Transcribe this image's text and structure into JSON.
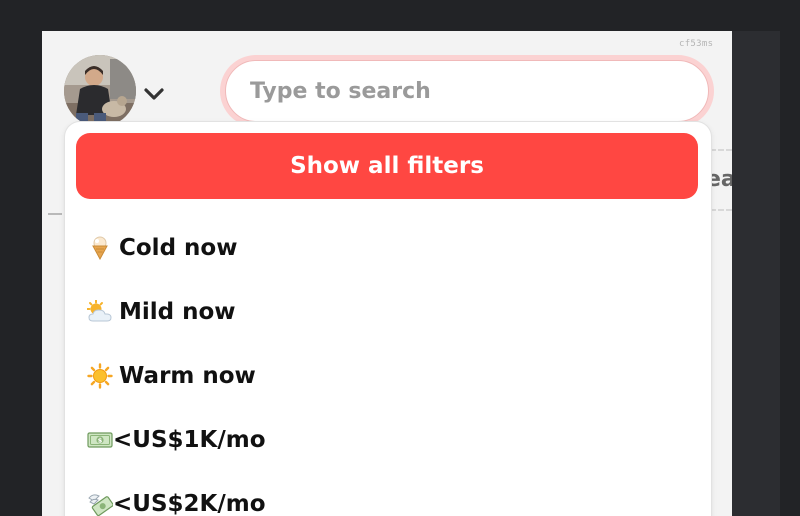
{
  "header": {
    "timing_label": "cf53ms",
    "avatar_icon": "user-avatar-photo",
    "avatar_menu_icon": "chevron-down-icon"
  },
  "search": {
    "placeholder": "Type to search",
    "value": ""
  },
  "background": {
    "partial_text": "ea"
  },
  "dropdown": {
    "show_all_label": "Show all filters",
    "items": [
      {
        "icon": "ice-cream-icon",
        "label": "Cold now"
      },
      {
        "icon": "sun-behind-cloud-icon",
        "label": "Mild now"
      },
      {
        "icon": "sun-icon",
        "label": "Warm now"
      },
      {
        "icon": "dollar-banknote-icon",
        "label": "<US$1K/mo"
      },
      {
        "icon": "money-with-wings-icon",
        "label": "<US$2K/mo"
      }
    ]
  },
  "colors": {
    "accent": "#ff4742",
    "search_ring": "#fbd2d2",
    "panel_bg": "#f3f3f3",
    "page_bg": "#222326"
  }
}
